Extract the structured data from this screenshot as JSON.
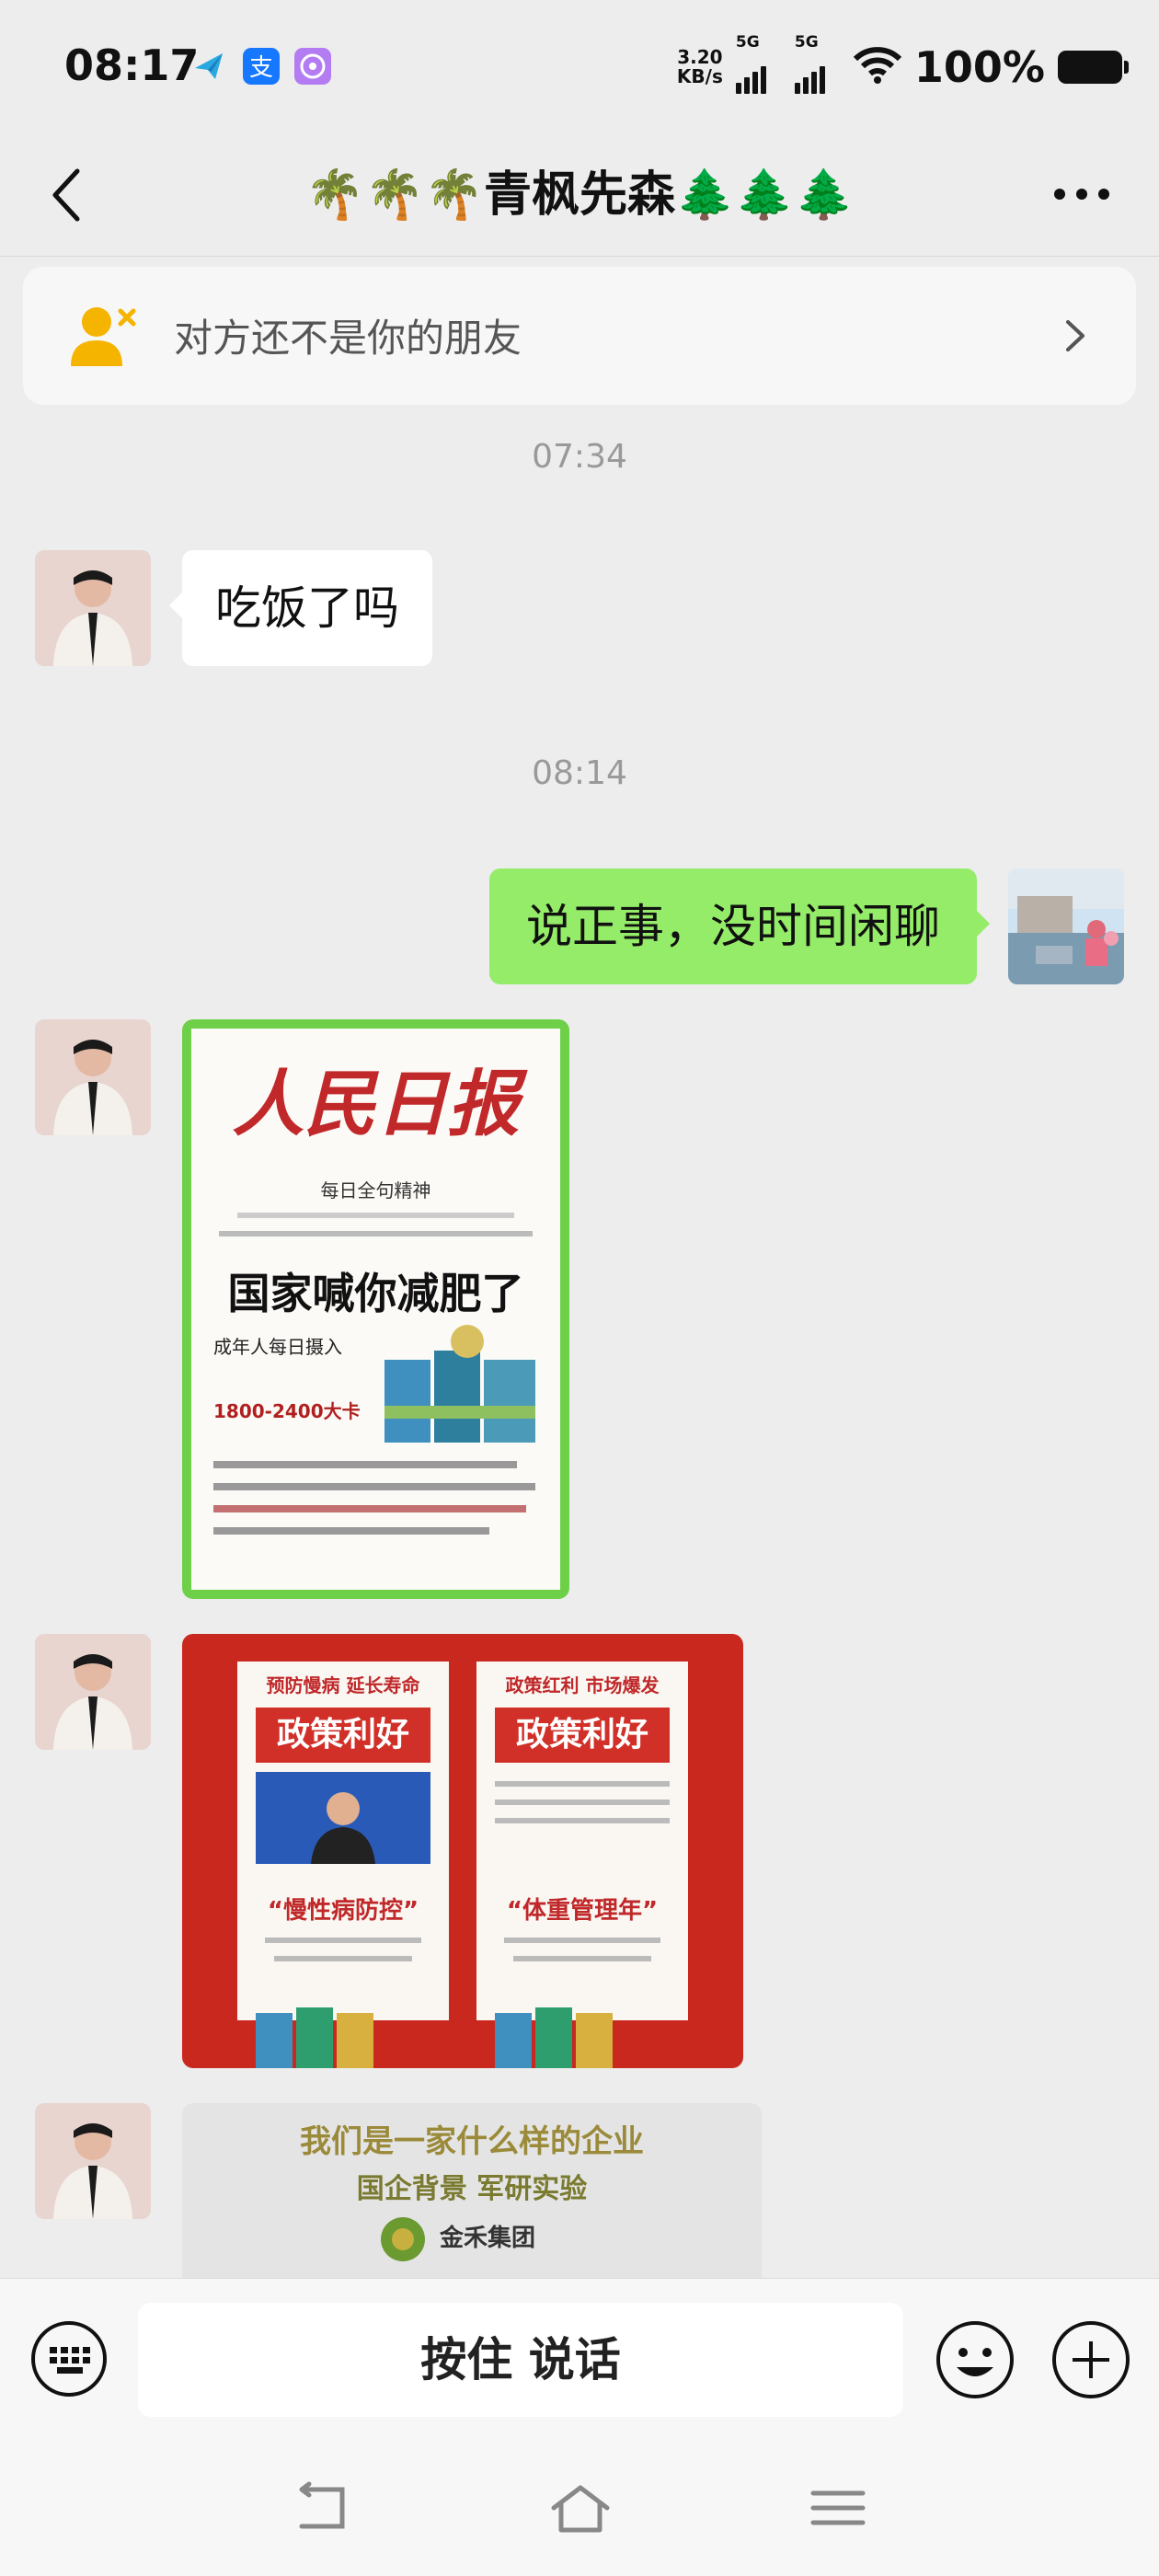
{
  "status_bar": {
    "time": "08:17",
    "speed_value": "3.20",
    "speed_unit": "KB/s",
    "network1": "5G",
    "network2": "5G",
    "battery": "100%"
  },
  "nav": {
    "title": "🌴🌴🌴青枫先森🌲🌲🌲"
  },
  "notice": {
    "text": "对方还不是你的朋友"
  },
  "messages": [
    {
      "time": "07:34"
    },
    {
      "text": "吃饭了吗"
    },
    {
      "time": "08:14"
    },
    {
      "text": "说正事，没时间闲聊"
    }
  ],
  "images": {
    "newspaper": {
      "masthead": "人民日报",
      "headline": "国家喊你减肥了",
      "small1": "每日全句精神",
      "small2": "成年人每日摄入",
      "small3": "1800-2400大卡"
    },
    "policy": {
      "left_top": "预防慢病 延长寿命",
      "left_banner": "政策利好",
      "left_quote": "“慢性病防控”",
      "right_top": "政策红利 市场爆发",
      "right_banner": "政策利好",
      "right_quote": "“体重管理年”"
    },
    "company": {
      "line1": "我们是一家什么样的企业",
      "line2": "国企背景 军研实验",
      "logo_text": "金禾集团"
    }
  },
  "input": {
    "voice_label": "按住 说话"
  },
  "colors": {
    "bubble_self": "#95ec69",
    "background": "#ededed",
    "notice_icon": "#f5b400"
  }
}
